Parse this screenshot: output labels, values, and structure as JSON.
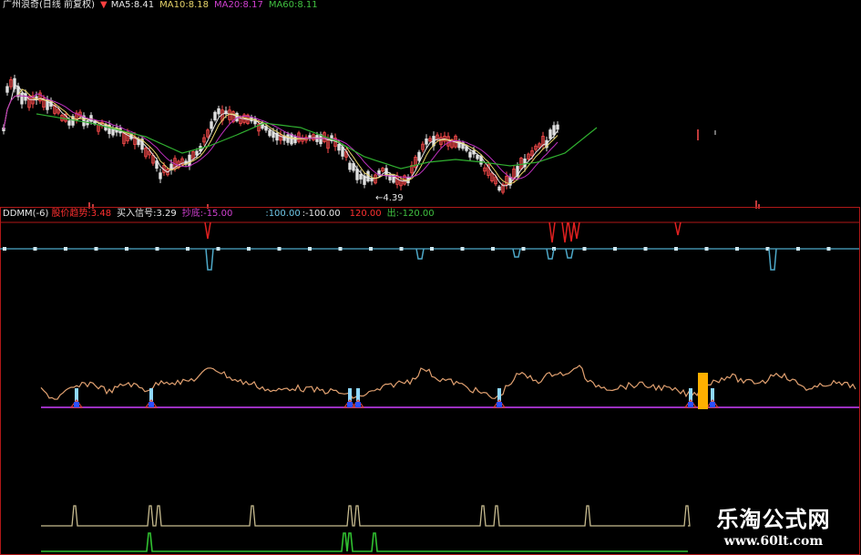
{
  "colors": {
    "bg": "#000000",
    "candle_up": "#ff4d4d",
    "candle_down": "#e0e0e0",
    "ma5": "#e8e8e8",
    "ma10": "#e8d46a",
    "ma20": "#c030c0",
    "ma60": "#30b030",
    "panel_border": "#b01818",
    "ddmm_white": "#cfe8f2",
    "ddmm_red": "#e02020",
    "ddmm_blue": "#4ea8c8",
    "osc_line": "#e0a070",
    "osc_base": "#9a2fbf",
    "signal_cyan": "#8fd8ff",
    "signal_blue": "#2a50ff",
    "signal_red": "#d04040",
    "highlight": "#ffb000",
    "pulse_tan": "#c8bc90",
    "pulse_green": "#30c030"
  },
  "top_header": {
    "title": "广州浪奇(日线 前复权)",
    "title_color": "#e8e8e8",
    "arrow_icon": "down-triangle-icon",
    "ma5": "MA5:8.41",
    "ma10": "MA10:8.18",
    "ma20": "MA20:8.17",
    "ma60": "MA60:8.11"
  },
  "indicator_header": {
    "name": "DDMM(-6)",
    "stock_trend": "股价趋势:3.48",
    "buy_signal": "买入信号:3.29",
    "bottom_fish": "抄底:-15.00",
    "val1": ":100.00",
    "val2": ":-100.00",
    "val3": "120.00",
    "exit": "出:-120.00"
  },
  "price_annotations": {
    "low_label": "←4.39"
  },
  "watermark": {
    "line1": "乐淘公式网",
    "line2": "www.60lt.com"
  }
}
